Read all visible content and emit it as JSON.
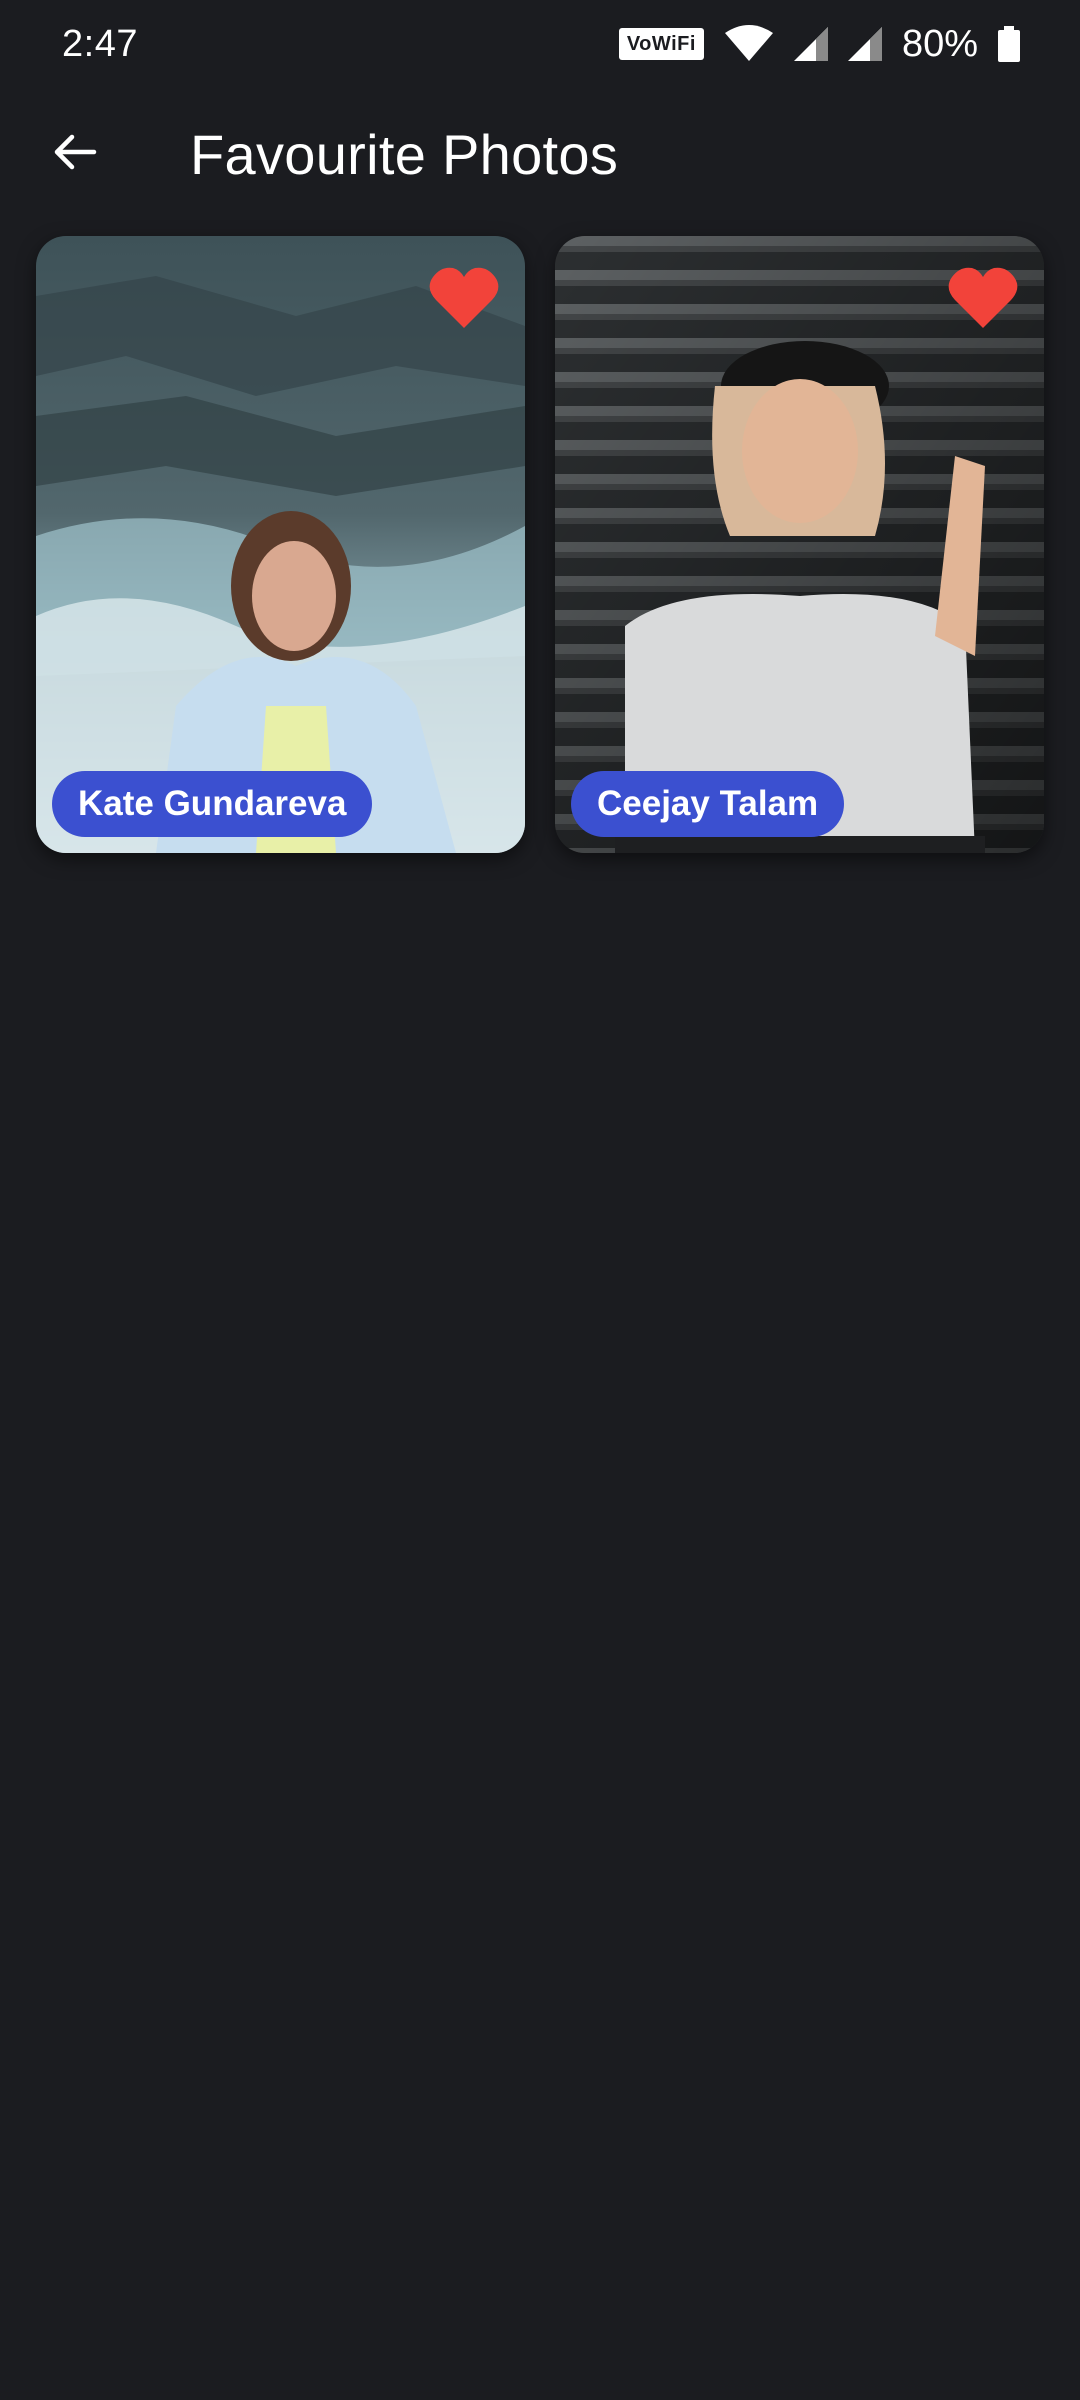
{
  "status_bar": {
    "time": "2:47",
    "vowifi_label": "VoWiFi",
    "battery_percent": "80%",
    "icons": [
      "vowifi-icon",
      "wifi-icon",
      "signal-icon",
      "signal-icon",
      "battery-icon"
    ]
  },
  "app_bar": {
    "back_icon": "arrow-back-icon",
    "title": "Favourite Photos"
  },
  "photos": [
    {
      "name": "Kate Gundareva",
      "favorite": true,
      "favorite_icon": "heart-icon"
    },
    {
      "name": "Ceejay Talam",
      "favorite": true,
      "favorite_icon": "heart-icon"
    }
  ],
  "colors": {
    "background": "#1b1c20",
    "badge": "#3b50d0",
    "heart": "#f2433a"
  }
}
